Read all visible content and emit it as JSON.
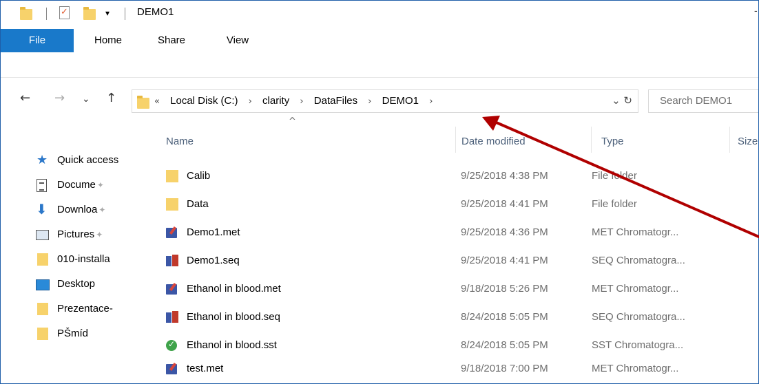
{
  "window": {
    "title": "DEMO1",
    "qa_dropdown_glyph": "▾",
    "min_glyph": "-"
  },
  "ribbon": {
    "tabs": [
      "File",
      "Home",
      "Share",
      "View"
    ]
  },
  "nav": {
    "back_glyph": "←",
    "forward_glyph": "→",
    "recent_glyph": "⌄",
    "up_glyph": "↑"
  },
  "address": {
    "overflow": "«",
    "crumbs": [
      "Local Disk (C:)",
      "clarity",
      "DataFiles",
      "DEMO1"
    ],
    "separator": "›",
    "dropdown_glyph": "⌄",
    "refresh_glyph": "↻"
  },
  "search": {
    "placeholder": "Search DEMO1"
  },
  "navpane": {
    "items": [
      {
        "label": "Quick access",
        "icon": "star-icon",
        "pinned": false
      },
      {
        "label": "Docume",
        "icon": "documents-icon",
        "pinned": true
      },
      {
        "label": "Downloa",
        "icon": "download-icon",
        "pinned": true
      },
      {
        "label": "Pictures",
        "icon": "pictures-icon",
        "pinned": true
      },
      {
        "label": "010-installa",
        "icon": "folder-icon",
        "pinned": false
      },
      {
        "label": "Desktop",
        "icon": "desktop-icon",
        "pinned": false
      },
      {
        "label": "Prezentace-",
        "icon": "folder-icon",
        "pinned": false
      },
      {
        "label": "PŠmíd",
        "icon": "folder-icon",
        "pinned": false
      }
    ],
    "pin_glyph": "✦"
  },
  "columns": {
    "sort_indicator": "^",
    "name": "Name",
    "date": "Date modified",
    "type": "Type",
    "size": "Size"
  },
  "files": [
    {
      "name": "Calib",
      "date": "9/25/2018 4:38 PM",
      "type": "File folder",
      "icon": "folder-icon"
    },
    {
      "name": "Data",
      "date": "9/25/2018 4:41 PM",
      "type": "File folder",
      "icon": "folder-icon"
    },
    {
      "name": "Demo1.met",
      "date": "9/25/2018 4:36 PM",
      "type": "MET Chromatogr...",
      "icon": "met-file-icon"
    },
    {
      "name": "Demo1.seq",
      "date": "9/25/2018 4:41 PM",
      "type": "SEQ Chromatogra...",
      "icon": "seq-file-icon"
    },
    {
      "name": "Ethanol in blood.met",
      "date": "9/18/2018 5:26 PM",
      "type": "MET Chromatogr...",
      "icon": "met-file-icon"
    },
    {
      "name": "Ethanol in blood.seq",
      "date": "8/24/2018 5:05 PM",
      "type": "SEQ Chromatogra...",
      "icon": "seq-file-icon"
    },
    {
      "name": "Ethanol in blood.sst",
      "date": "8/24/2018 5:05 PM",
      "type": "SST Chromatogra...",
      "icon": "sst-file-icon"
    },
    {
      "name": "test.met",
      "date": "9/18/2018 7:00 PM",
      "type": "MET Chromatogr...",
      "icon": "met-file-icon"
    }
  ],
  "colors": {
    "file_tab": "#1979ca",
    "annotation_arrow": "#b00000",
    "folder": "#f7d26b"
  }
}
